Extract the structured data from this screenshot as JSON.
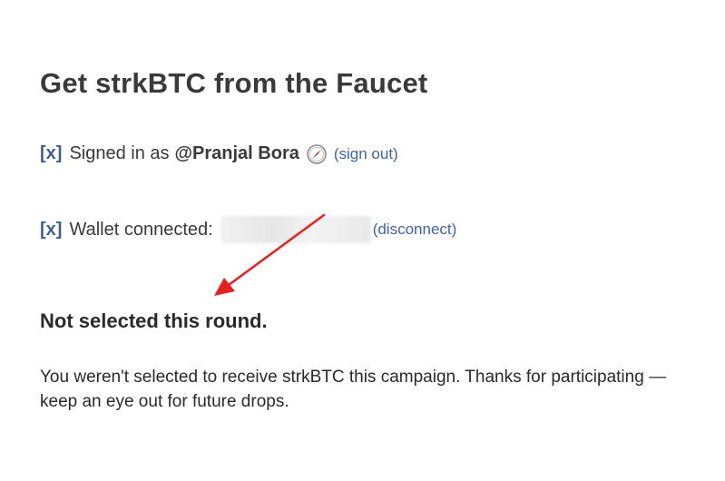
{
  "header": {
    "title": "Get strkBTC from the Faucet"
  },
  "signin": {
    "status_marker": "[x]",
    "label": "Signed in as",
    "username": "@Pranjal Bora",
    "icon": "compass-icon",
    "action_label": "(sign out)"
  },
  "wallet": {
    "status_marker": "[x]",
    "label": "Wallet connected:",
    "address": "",
    "action_label": "(disconnect)"
  },
  "result": {
    "heading": "Not selected this round.",
    "message": "You weren't selected to receive strkBTC this campaign. Thanks for participating — keep an eye out for future drops."
  },
  "colors": {
    "link": "#3d63a8",
    "marker": "#3d5f95",
    "annotation_arrow": "#e8201f",
    "text": "#2a2a2a"
  }
}
